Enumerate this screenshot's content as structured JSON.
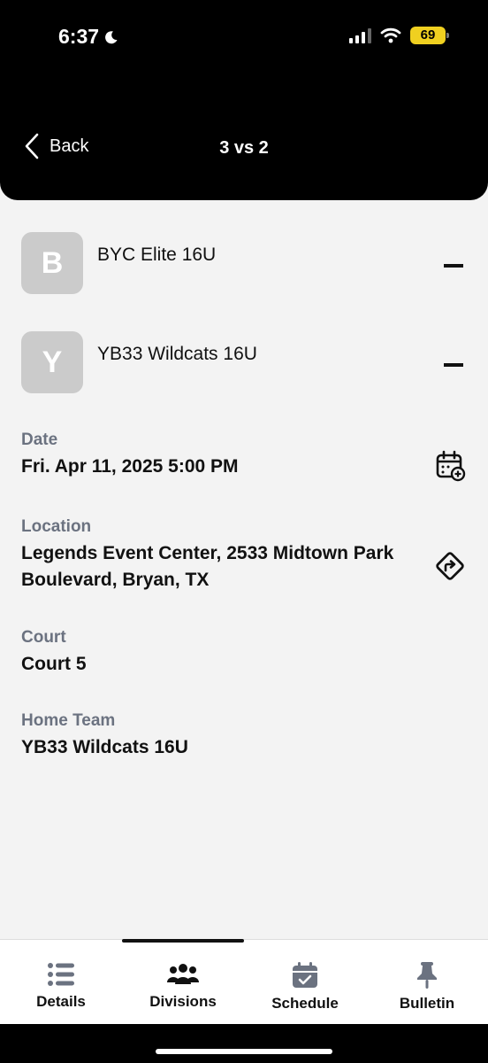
{
  "status_bar": {
    "time": "6:37",
    "battery": "69"
  },
  "nav": {
    "back_label": "Back",
    "title": "3 vs 2"
  },
  "teams": [
    {
      "initial": "B",
      "name": "BYC Elite 16U",
      "score": "–"
    },
    {
      "initial": "Y",
      "name": "YB33 Wildcats 16U",
      "score": "–"
    }
  ],
  "details": {
    "date": {
      "label": "Date",
      "value": "Fri. Apr 11, 2025 5:00 PM"
    },
    "location": {
      "label": "Location",
      "value": "Legends Event Center, 2533 Midtown Park Boulevard, Bryan, TX"
    },
    "court": {
      "label": "Court",
      "value": "Court 5"
    },
    "home_team": {
      "label": "Home Team",
      "value": "YB33 Wildcats 16U"
    }
  },
  "tabs": [
    {
      "label": "Details",
      "icon": "list-icon",
      "active": false
    },
    {
      "label": "Divisions",
      "icon": "people-icon",
      "active": true
    },
    {
      "label": "Schedule",
      "icon": "calendar-check-icon",
      "active": false
    },
    {
      "label": "Bulletin",
      "icon": "pin-icon",
      "active": false
    }
  ],
  "colors": {
    "header_bg": "#000000",
    "content_bg": "#f3f3f3",
    "battery": "#f0d020",
    "muted_label": "#6b7280"
  }
}
